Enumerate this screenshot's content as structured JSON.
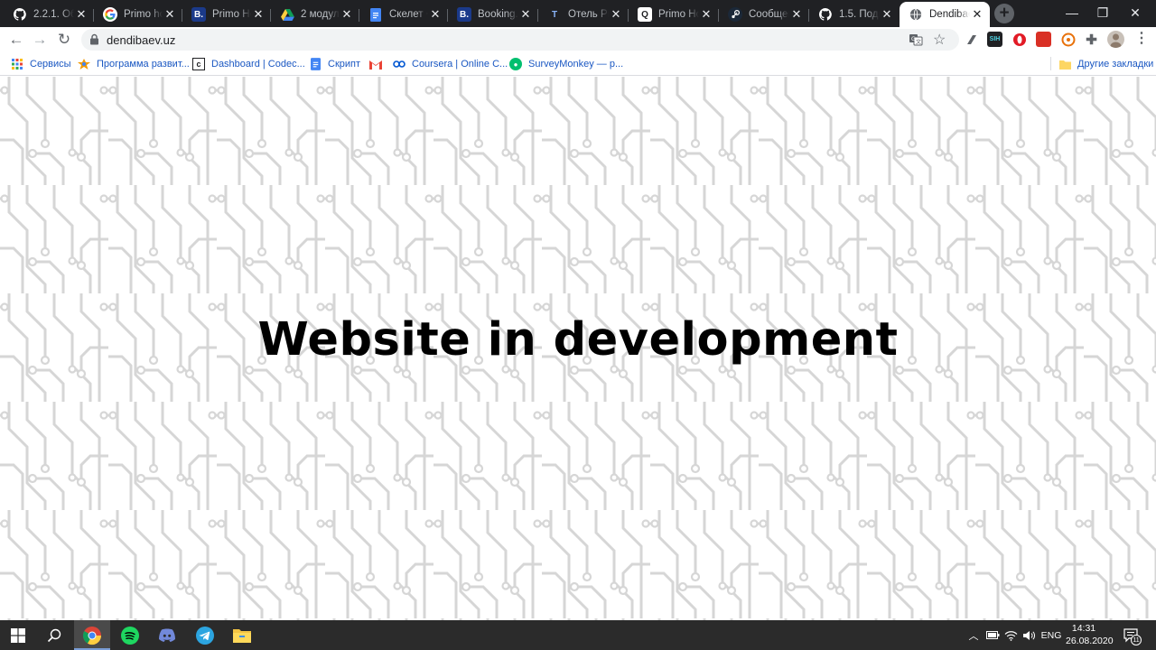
{
  "browser": {
    "tabs": [
      {
        "title": "2.2.1. Обн",
        "icon": "github-octocat-icon",
        "color": "#ffffff",
        "glyph": ""
      },
      {
        "title": "Primo hot",
        "icon": "google-icon",
        "color": "#ffffff",
        "glyph": "G"
      },
      {
        "title": "Primo Hot",
        "icon": "booking-icon",
        "color": "#1b3a8a",
        "glyph": "B."
      },
      {
        "title": "2 модуль",
        "icon": "google-drive-icon",
        "color": "#ffffff",
        "glyph": ""
      },
      {
        "title": "Скелет +",
        "icon": "google-docs-icon",
        "color": "#4285f4",
        "glyph": ""
      },
      {
        "title": "Booking.c",
        "icon": "booking-icon",
        "color": "#1b3a8a",
        "glyph": "B."
      },
      {
        "title": "Отель Pri",
        "icon": "translate-icon",
        "color": "#ffffff",
        "glyph": "T"
      },
      {
        "title": "Primo Ho",
        "icon": "search-page-icon",
        "color": "#ffffff",
        "glyph": "Q"
      },
      {
        "title": "Сообщен",
        "icon": "steam-icon",
        "color": "#1b2838",
        "glyph": ""
      },
      {
        "title": "1.5. Подк",
        "icon": "github-octocat-icon",
        "color": "#ffffff",
        "glyph": ""
      },
      {
        "title": "Dendibaev",
        "icon": "globe-icon",
        "color": "#5f6368",
        "glyph": ""
      }
    ],
    "window_controls": {
      "minimize": "—",
      "maximize": "❐",
      "close": "✕"
    },
    "toolbar": {
      "url": "dendibaev.uz",
      "back": "←",
      "forward": "→",
      "reload": "↻"
    },
    "bookmarks": [
      {
        "label": "Сервисы",
        "icon": "apps-grid-icon"
      },
      {
        "label": "Программа развит...",
        "icon": "colorful-star-icon"
      },
      {
        "label": "Dashboard | Codec...",
        "icon": "codecademy-icon"
      },
      {
        "label": "Скрипт",
        "icon": "google-docs-icon"
      },
      {
        "label": "",
        "icon": "gmail-icon"
      },
      {
        "label": "Coursera | Online C...",
        "icon": "coursera-icon"
      },
      {
        "label": "SurveyMonkey — p...",
        "icon": "surveymonkey-icon"
      }
    ],
    "other_bookmarks": "Другие закладки"
  },
  "page": {
    "headline": "Website in development"
  },
  "taskbar": {
    "apps": [
      {
        "name": "windows-start-icon"
      },
      {
        "name": "search-icon"
      },
      {
        "name": "chrome-icon"
      },
      {
        "name": "spotify-icon"
      },
      {
        "name": "discord-icon"
      },
      {
        "name": "telegram-icon"
      },
      {
        "name": "file-explorer-icon"
      }
    ],
    "tray": {
      "language": "ENG",
      "time": "14:31",
      "date": "26.08.2020",
      "notifications": "11"
    }
  },
  "colors": {
    "tabstrip": "#202124",
    "accent_link": "#1a57c2",
    "taskbar": "#2b2b2b",
    "pattern_stroke": "#d6d6d6"
  }
}
